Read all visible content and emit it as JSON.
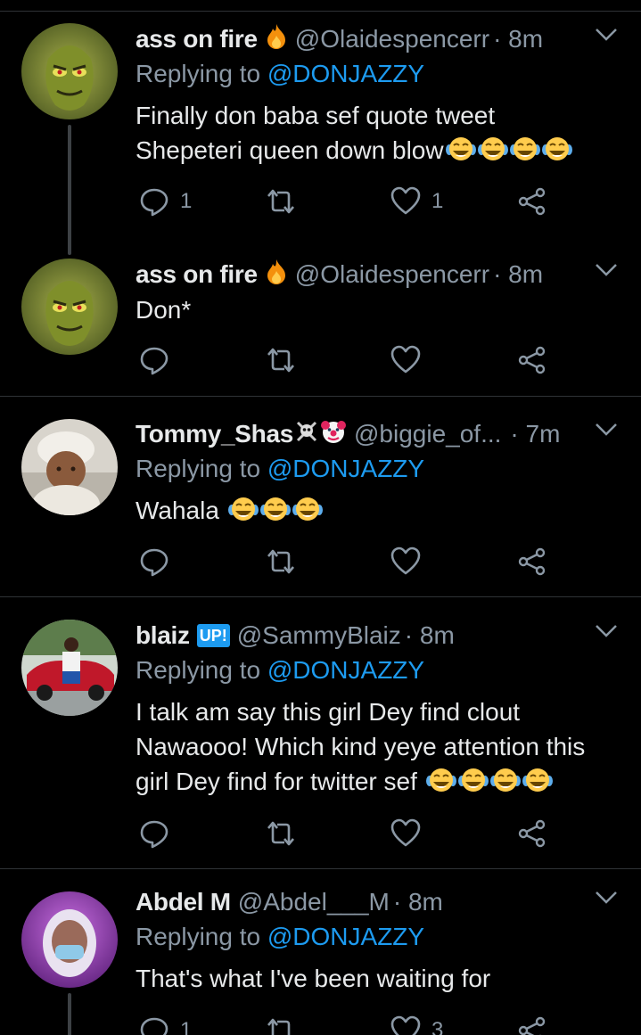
{
  "tweets": [
    {
      "name": "ass on fire",
      "emoji": "fire",
      "handle": "@Olaidespencerr",
      "time": "· 8m",
      "replying_prefix": "Replying to",
      "replying_to": "@DONJAZZY",
      "text_lines": [
        "Finally don baba sef quote tweet",
        "Shepeteri queen down blow"
      ],
      "trailing_emoji": "😂😂😂😂",
      "reply_count": "1",
      "retweet_count": "",
      "like_count": "1",
      "avatar": "grinch-avatar"
    },
    {
      "name": "ass on fire",
      "emoji": "fire",
      "handle": "@Olaidespencerr",
      "time": "· 8m",
      "text_lines": [
        "Don*"
      ],
      "reply_count": "",
      "retweet_count": "",
      "like_count": "",
      "avatar": "grinch-avatar"
    },
    {
      "name": "Tommy_Shas",
      "emoji": "skull-crossbones clown",
      "handle": "@biggie_of...",
      "time": "· 7m",
      "replying_prefix": "Replying to",
      "replying_to": "@DONJAZZY",
      "text_lines": [
        "Wahala"
      ],
      "trailing_emoji": "😂😂😂",
      "reply_count": "",
      "retweet_count": "",
      "like_count": "",
      "avatar": "baby-avatar"
    },
    {
      "name": "blaiz",
      "badge": "UP!",
      "handle": "@SammyBlaiz",
      "time": "· 8m",
      "replying_prefix": "Replying to",
      "replying_to": "@DONJAZZY",
      "text_lines": [
        "I talk am say this girl Dey find clout",
        "Nawaooo! Which kind yeye attention this",
        "girl Dey find for twitter sef"
      ],
      "trailing_emoji": "😂😂😂😂",
      "reply_count": "",
      "retweet_count": "",
      "like_count": "",
      "avatar": "car-avatar"
    },
    {
      "name": "Abdel M",
      "handle": "@Abdel___M",
      "time": "· 8m",
      "replying_prefix": "Replying to",
      "replying_to": "@DONJAZZY",
      "text_lines": [
        "That's what I've been waiting for"
      ],
      "reply_count": "1",
      "retweet_count": "",
      "like_count": "3",
      "avatar": "purple-avatar"
    }
  ],
  "colors": {
    "background": "#000000",
    "text": "#e7e9ea",
    "muted": "#8b98a5",
    "link": "#1d9bf0",
    "divider": "#2f3336"
  }
}
